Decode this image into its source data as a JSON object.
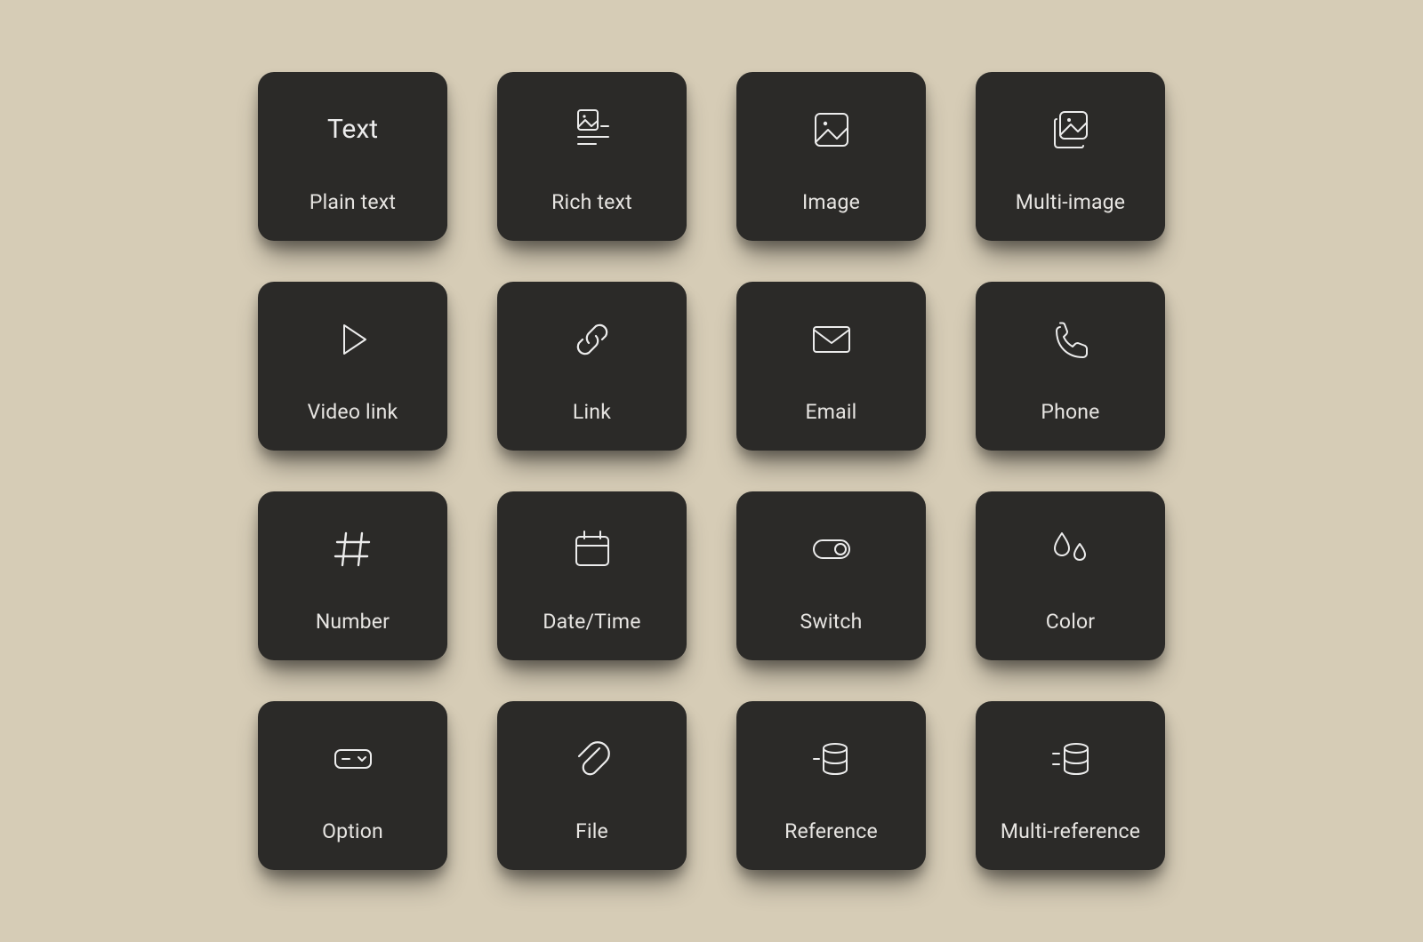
{
  "tiles": [
    {
      "label": "Plain text",
      "icon": "text-icon"
    },
    {
      "label": "Rich text",
      "icon": "rich-text-icon"
    },
    {
      "label": "Image",
      "icon": "image-icon"
    },
    {
      "label": "Multi-image",
      "icon": "multi-image-icon"
    },
    {
      "label": "Video link",
      "icon": "play-icon"
    },
    {
      "label": "Link",
      "icon": "link-icon"
    },
    {
      "label": "Email",
      "icon": "mail-icon"
    },
    {
      "label": "Phone",
      "icon": "phone-icon"
    },
    {
      "label": "Number",
      "icon": "hash-icon"
    },
    {
      "label": "Date/Time",
      "icon": "calendar-icon"
    },
    {
      "label": "Switch",
      "icon": "toggle-icon"
    },
    {
      "label": "Color",
      "icon": "droplets-icon"
    },
    {
      "label": "Option",
      "icon": "option-icon"
    },
    {
      "label": "File",
      "icon": "paperclip-icon"
    },
    {
      "label": "Reference",
      "icon": "database-ref-icon"
    },
    {
      "label": "Multi-reference",
      "icon": "database-multi-ref-icon"
    }
  ],
  "iconText": {
    "text-icon": "Text"
  },
  "colors": {
    "background": "#d6ccb6",
    "tile": "#2b2a28",
    "text": "#e7e5e2",
    "icon": "#ececec"
  }
}
